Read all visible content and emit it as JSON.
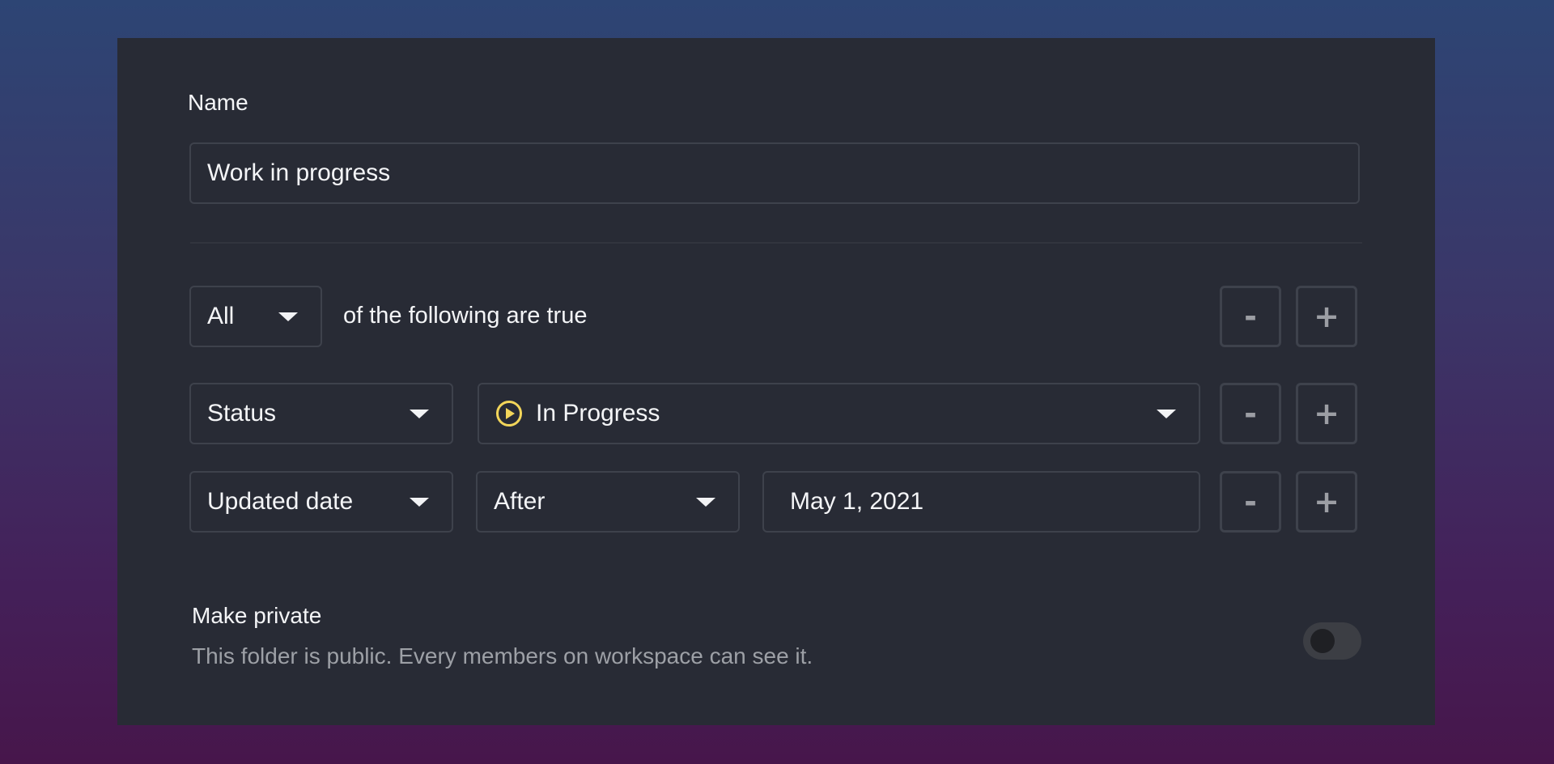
{
  "form": {
    "name_label": "Name",
    "name_value": "Work in progress"
  },
  "rules": {
    "quantifier": "All",
    "quantifier_suffix": "of the following are true",
    "conditions": [
      {
        "field": "Status",
        "value": "In Progress",
        "value_icon": "play-circle-icon"
      },
      {
        "field": "Updated date",
        "operator": "After",
        "value": "May 1, 2021"
      }
    ],
    "remove_label": "-",
    "add_label": "+"
  },
  "privacy": {
    "title": "Make private",
    "description": "This folder is public. Every members on workspace can see it.",
    "enabled": false
  },
  "colors": {
    "status_in_progress": "#f2d55a",
    "panel_bg": "#282b35"
  }
}
